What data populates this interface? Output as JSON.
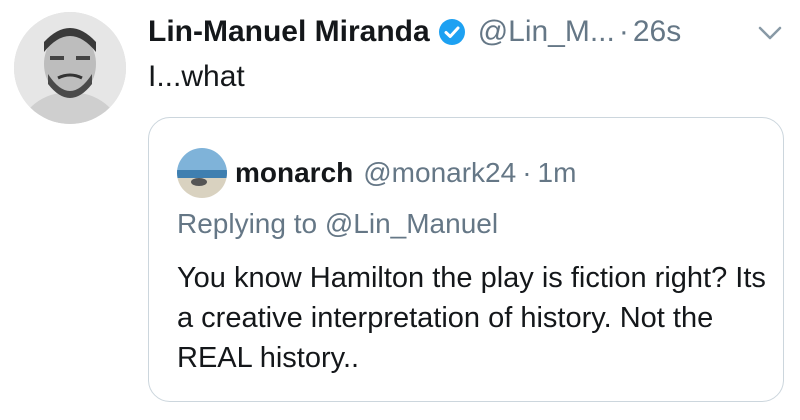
{
  "tweet": {
    "author_name": "Lin-Manuel Miranda",
    "handle": "@Lin_M...",
    "separator": "·",
    "time": "26s",
    "text": "I...what",
    "avatar_icon": "person-avatar",
    "verified_icon": "verified-badge-icon",
    "menu_icon": "chevron-down-icon"
  },
  "quoted": {
    "author_name": "monarch",
    "handle": "@monark24",
    "separator": "·",
    "time": "1m",
    "replying_to": "Replying to @Lin_Manuel",
    "text": "You know Hamilton the play is fiction right?  Its a creative interpretation of history. Not the REAL history..",
    "avatar_icon": "beach-avatar"
  },
  "colors": {
    "primary_text": "#14171a",
    "secondary_text": "#657786",
    "verified_blue": "#1da1f2",
    "border": "#ccd6dd"
  }
}
